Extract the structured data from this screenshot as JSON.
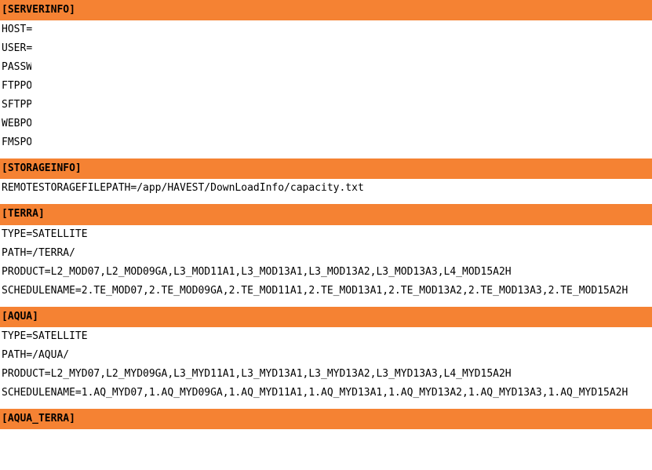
{
  "sections": [
    {
      "id": "serverinfo",
      "header": "[SERVERINFO]",
      "lines": [
        {
          "key": "HOST",
          "clip": false,
          "value": ""
        },
        {
          "key": "USER",
          "clip": false,
          "value": ""
        },
        {
          "key": "PASSW",
          "clip": true,
          "value": ""
        },
        {
          "key": "FTPPO",
          "clip": true,
          "value": ""
        },
        {
          "key": "SFTPP",
          "clip": true,
          "value": ""
        },
        {
          "key": "WEBPO",
          "clip": true,
          "value": ""
        },
        {
          "key": "FMSPO",
          "clip": true,
          "value": ""
        }
      ]
    },
    {
      "id": "storageinfo",
      "header": "[STORAGEINFO]",
      "lines": [
        {
          "key": "REMOTESTORAGEFILEPATH",
          "clip": false,
          "value": "/app/HAVEST/DownLoadInfo/capacity.txt"
        }
      ]
    },
    {
      "id": "terra",
      "header": "[TERRA]",
      "lines": [
        {
          "key": "TYPE",
          "value": "SATELLITE"
        },
        {
          "key": "PATH",
          "value": "/TERRA/"
        },
        {
          "key": "PRODUCT",
          "value": "L2_MOD07,L2_MOD09GA,L3_MOD11A1,L3_MOD13A1,L3_MOD13A2,L3_MOD13A3,L4_MOD15A2H"
        },
        {
          "key": "SCHEDULENAME",
          "value": "2.TE_MOD07,2.TE_MOD09GA,2.TE_MOD11A1,2.TE_MOD13A1,2.TE_MOD13A2,2.TE_MOD13A3,2.TE_MOD15A2H"
        }
      ]
    },
    {
      "id": "aqua",
      "header": "[AQUA]",
      "lines": [
        {
          "key": "TYPE",
          "value": "SATELLITE"
        },
        {
          "key": "PATH",
          "value": "/AQUA/"
        },
        {
          "key": "PRODUCT",
          "value": "L2_MYD07,L2_MYD09GA,L3_MYD11A1,L3_MYD13A1,L3_MYD13A2,L3_MYD13A3,L4_MYD15A2H"
        },
        {
          "key": "SCHEDULENAME",
          "value": "1.AQ_MYD07,1.AQ_MYD09GA,1.AQ_MYD11A1,1.AQ_MYD13A1,1.AQ_MYD13A2,1.AQ_MYD13A3,1.AQ_MYD15A2H"
        }
      ]
    },
    {
      "id": "aqua_terra",
      "header": "[AQUA_TERRA]",
      "lines": []
    }
  ]
}
